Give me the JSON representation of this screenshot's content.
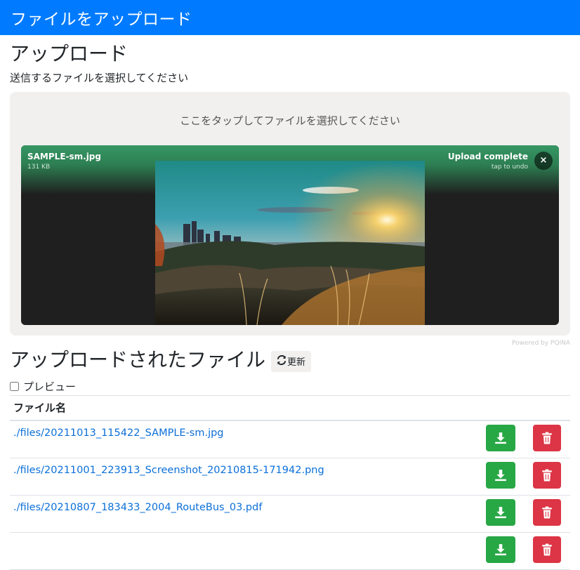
{
  "navbar": {
    "title": "ファイルをアップロード"
  },
  "upload": {
    "heading": "アップロード",
    "description": "送信するファイルを選択してください",
    "drop_label": "ここをタップしてファイルを選択してください",
    "item": {
      "file_name": "SAMPLE-sm.jpg",
      "file_size": "131 KB",
      "status": "Upload complete",
      "status_sub": "tap to undo",
      "remove_label": "×"
    },
    "credit": "Powered by PQINA"
  },
  "uploaded": {
    "heading": "アップロードされたファイル",
    "refresh_label": "更新",
    "preview_label": "プレビュー",
    "column_header": "ファイル名",
    "files": [
      "./files/20211013_115422_SAMPLE-sm.jpg",
      "./files/20211001_223913_Screenshot_20210815-171942.png",
      "./files/20210807_183433_2004_RouteBus_03.pdf",
      ""
    ]
  },
  "colors": {
    "navbar": "#007bff",
    "download": "#28a745",
    "delete": "#dc3545",
    "link": "#0b6fd8"
  },
  "icons": {
    "download": "download-icon",
    "delete": "trash-icon",
    "refresh": "refresh-icon",
    "remove": "close-icon"
  }
}
